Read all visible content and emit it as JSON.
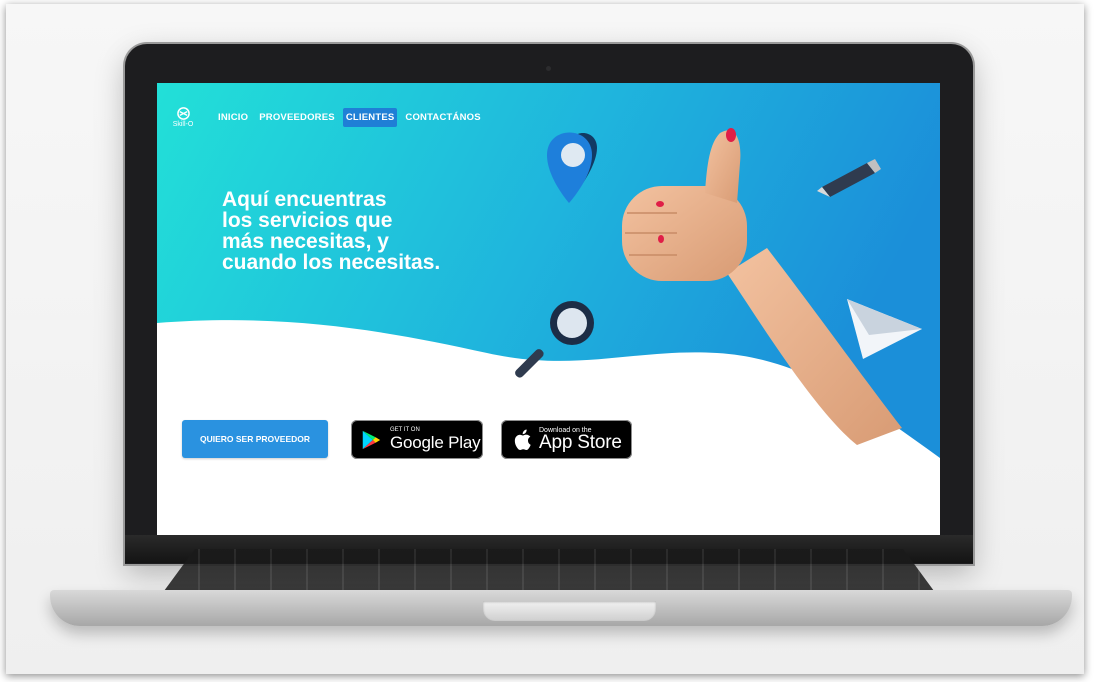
{
  "logo": {
    "name": "Skill-O"
  },
  "nav": {
    "items": [
      {
        "label": "INICIO",
        "active": false
      },
      {
        "label": "PROVEEDORES",
        "active": false
      },
      {
        "label": "CLIENTES",
        "active": true
      },
      {
        "label": "CONTACTÁNOS",
        "active": false
      }
    ]
  },
  "hero": {
    "lines": [
      "Aquí encuentras",
      "los servicios que",
      "más necesitas, y",
      "cuando los necesitas."
    ]
  },
  "cta": {
    "label": "QUIERO SER PROVEEDOR"
  },
  "stores": {
    "google_play": {
      "small": "GET IT ON",
      "big": "Google Play"
    },
    "app_store": {
      "small": "Download on the",
      "big": "App Store"
    }
  },
  "icons": [
    "location-pin-icon",
    "pencil-icon",
    "magnifier-icon",
    "paper-plane-icon",
    "thumbs-up-image",
    "apple-icon",
    "google-play-icon",
    "logo-icon"
  ],
  "colors": {
    "gradient_start": "#22e0d8",
    "gradient_end": "#1b8fd9",
    "active_nav": "#1f7fd6",
    "cta": "#2a92e0"
  }
}
